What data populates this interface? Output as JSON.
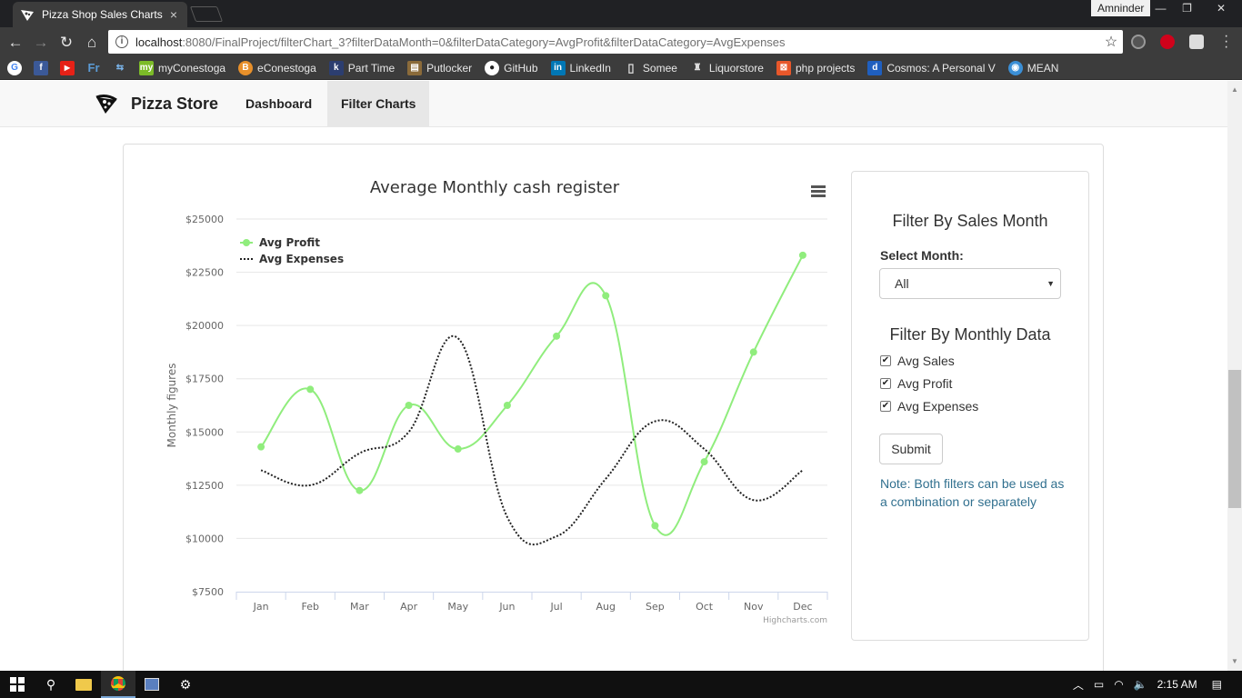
{
  "browser": {
    "tab_title": "Pizza Shop Sales Charts",
    "tab_close": "×",
    "user": "Amninder",
    "url_host": "localhost",
    "url_rest": ":8080/FinalProject/filterChart_3?filterDataMonth=0&filterDataCategory=AvgProfit&filterDataCategory=AvgExpenses",
    "bookmarks": [
      {
        "label": "",
        "color": "#4285f4",
        "glyph": "G"
      },
      {
        "label": "",
        "color": "#3b5998",
        "glyph": "f"
      },
      {
        "label": "",
        "color": "#e62117",
        "glyph": "▶"
      },
      {
        "label": "",
        "color": "#2a5a8a",
        "glyph": "Fr"
      },
      {
        "label": "",
        "color": "#2d6fa8",
        "glyph": "⇆"
      },
      {
        "label": "myConestoga",
        "color": "#7cbb28",
        "glyph": "my"
      },
      {
        "label": "eConestoga",
        "color": "#e8902a",
        "glyph": "B"
      },
      {
        "label": "Part Time",
        "color": "#2c3e70",
        "glyph": "k"
      },
      {
        "label": "Putlocker",
        "color": "#8b6b3a",
        "glyph": "▤"
      },
      {
        "label": "GitHub",
        "color": "#333333",
        "glyph": "●"
      },
      {
        "label": "LinkedIn",
        "color": "#0077b5",
        "glyph": "in"
      },
      {
        "label": "Somee",
        "color": "#3c3c3c",
        "glyph": "▯"
      },
      {
        "label": "Liquorstore",
        "color": "#3c3c3c",
        "glyph": "♜"
      },
      {
        "label": "php projects",
        "color": "#e8572a",
        "glyph": "⊠"
      },
      {
        "label": "Cosmos: A Personal V",
        "color": "#1f5fbf",
        "glyph": "d"
      },
      {
        "label": "MEAN",
        "color": "#3b8fd6",
        "glyph": "◉"
      }
    ]
  },
  "navbar": {
    "brand": "Pizza Store",
    "links": [
      "Dashboard",
      "Filter Charts"
    ]
  },
  "chart_data": {
    "type": "line",
    "title": "Average Monthly cash register",
    "ylabel": "Monthly figures",
    "xlabel": "",
    "categories": [
      "Jan",
      "Feb",
      "Mar",
      "Apr",
      "May",
      "Jun",
      "Jul",
      "Aug",
      "Sep",
      "Oct",
      "Nov",
      "Dec"
    ],
    "ylim": [
      7500,
      25000
    ],
    "yticks": [
      "$7500",
      "$10000",
      "$12500",
      "$15000",
      "$17500",
      "$20000",
      "$22500",
      "$25000"
    ],
    "series": [
      {
        "name": "Avg Profit",
        "color": "#90ed7d",
        "values": [
          14300,
          17000,
          12250,
          16250,
          14200,
          16250,
          19500,
          21400,
          10600,
          13600,
          18750,
          23300
        ]
      },
      {
        "name": "Avg Expenses",
        "color": "#222222",
        "values": [
          13200,
          12500,
          14000,
          15000,
          19400,
          11000,
          10100,
          12800,
          15500,
          14200,
          11800,
          13200
        ]
      }
    ],
    "grid": true,
    "legend_position": "top-left",
    "credits": "Highcharts.com"
  },
  "filters": {
    "month_heading": "Filter By Sales Month",
    "select_label": "Select Month:",
    "select_value": "All",
    "data_heading": "Filter By Monthly Data",
    "checkboxes": [
      {
        "label": "Avg Sales",
        "checked": true
      },
      {
        "label": "Avg Profit",
        "checked": true
      },
      {
        "label": "Avg Expenses",
        "checked": true
      }
    ],
    "submit_label": "Submit",
    "note": "Note: Both filters can be used as a combination or separately"
  },
  "taskbar": {
    "time": "2:15 AM"
  }
}
